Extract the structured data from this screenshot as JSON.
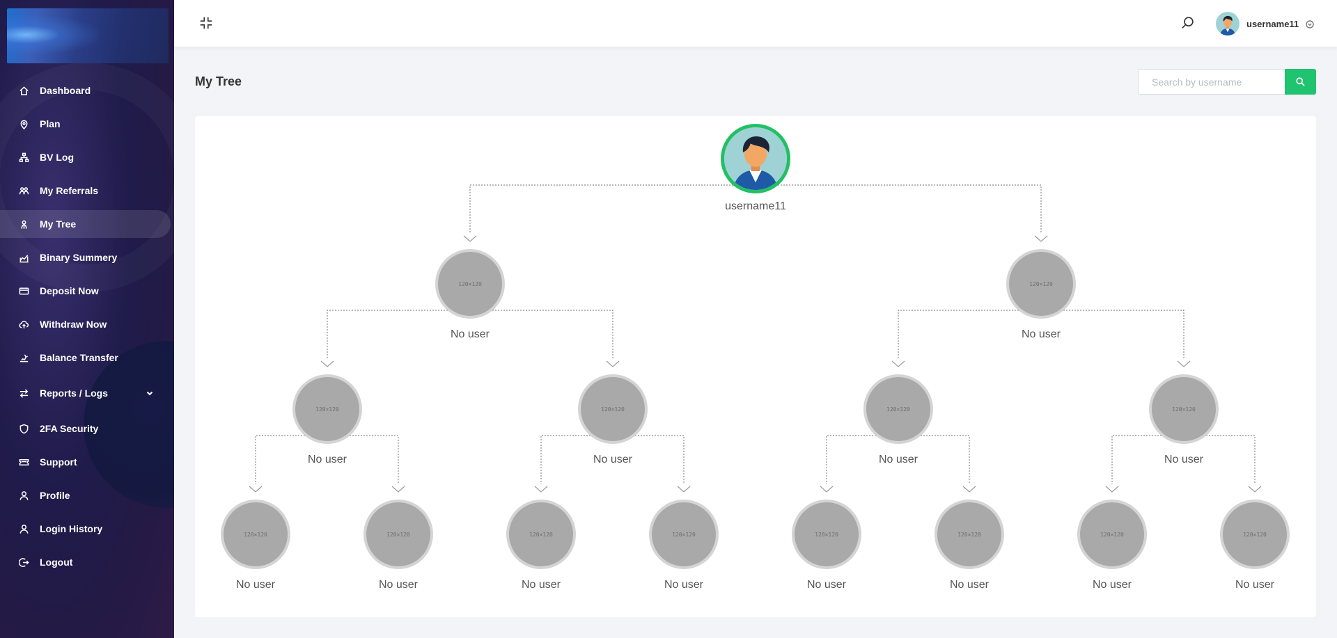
{
  "sidebar": {
    "items": [
      {
        "label": "Dashboard",
        "icon": "home-icon"
      },
      {
        "label": "Plan",
        "icon": "map-pin-icon"
      },
      {
        "label": "BV Log",
        "icon": "sitemap-icon"
      },
      {
        "label": "My Referrals",
        "icon": "users-icon"
      },
      {
        "label": "My Tree",
        "icon": "tree-icon",
        "active": true
      },
      {
        "label": "Binary Summery",
        "icon": "chart-icon"
      },
      {
        "label": "Deposit Now",
        "icon": "card-icon"
      },
      {
        "label": "Withdraw Now",
        "icon": "cloud-upload-icon"
      },
      {
        "label": "Balance Transfer",
        "icon": "transfer-icon"
      },
      {
        "label": "Reports / Logs",
        "icon": "exchange-icon",
        "has_submenu": true
      },
      {
        "label": "2FA Security",
        "icon": "shield-icon"
      },
      {
        "label": "Support",
        "icon": "ticket-icon"
      },
      {
        "label": "Profile",
        "icon": "user-icon"
      },
      {
        "label": "Login History",
        "icon": "user-icon"
      },
      {
        "label": "Logout",
        "icon": "logout-icon"
      }
    ]
  },
  "topbar": {
    "username": "username11"
  },
  "page": {
    "title": "My Tree",
    "search_placeholder": "Search by username"
  },
  "tree": {
    "root": {
      "label": "username11"
    },
    "placeholder_text": "120×120",
    "empty_label": "No user"
  },
  "colors": {
    "accent_green": "#20c36f",
    "sidebar_bg": "#1f1b4a"
  }
}
